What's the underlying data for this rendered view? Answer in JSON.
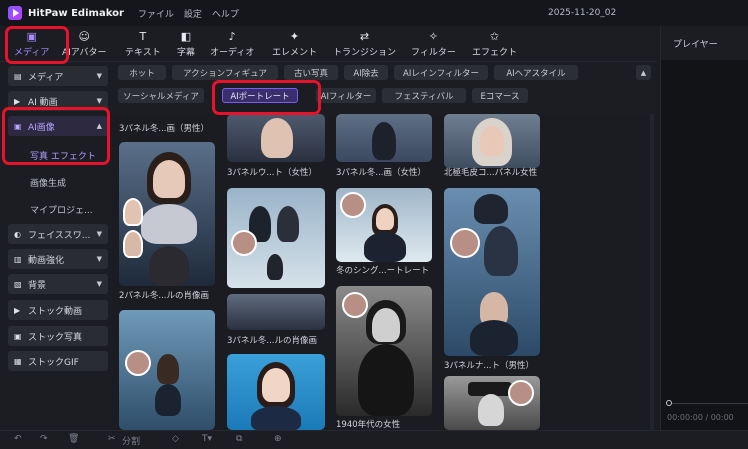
{
  "app": {
    "name": "HitPaw Edimakor",
    "menu": [
      "ファイル",
      "設定",
      "ヘルプ"
    ],
    "project": "2025-11-20_02"
  },
  "toolbar": {
    "tools": [
      {
        "label": "メディア",
        "icon": "media-icon"
      },
      {
        "label": "AIアバター",
        "icon": "avatar-icon"
      },
      {
        "label": "テキスト",
        "icon": "text-icon"
      },
      {
        "label": "字幕",
        "icon": "subtitle-icon"
      },
      {
        "label": "オーディオ",
        "icon": "audio-icon"
      },
      {
        "label": "エレメント",
        "icon": "element-icon"
      },
      {
        "label": "トランジション",
        "icon": "transition-icon"
      },
      {
        "label": "フィルター",
        "icon": "filter-icon"
      },
      {
        "label": "エフェクト",
        "icon": "effect-icon"
      }
    ]
  },
  "sidebar": {
    "media": "メディア",
    "ai_video": "AI 動画",
    "ai_image": "AI画像",
    "sub_items": [
      "写真 エフェクト",
      "画像生成",
      "マイプロジェ..."
    ],
    "face_swap": "フェイススワ...",
    "enhance": "動画強化",
    "background": "背景",
    "stock_video": "ストック動画",
    "stock_photo": "ストック写真",
    "stock_gif": "ストックGIF"
  },
  "chips": {
    "row1": [
      "ホット",
      "アクションフィギュア",
      "古い写真",
      "AI除去",
      "AIレインフィルター",
      "AIヘアスタイル"
    ],
    "row2": [
      "ソーシャルメディア",
      "AIポートレート",
      "AIフィルター",
      "フェスティバル",
      "Eコマース"
    ],
    "active": "AIポートレート"
  },
  "grid": {
    "captions": {
      "c1_top": "3パネル冬...画（男性）",
      "c1_mid": "2パネル冬...ルの肖像画",
      "c2_top": "3パネルウ...ト（女性）",
      "c2_mid": "3パネル冬...ルの肖像画",
      "c3_top": "3パネル冬...画（女性）",
      "c3_mid": "冬のシング...ートレート",
      "c3_bottom": "1940年代の女性",
      "c4_top": "北極毛皮コ...パネル女性",
      "c4_mid": "3パネルナ...ト（男性）"
    }
  },
  "player": {
    "title": "プレイヤー",
    "timecode": "00:00:00 / 00:00"
  },
  "bottom": {
    "split": "分割"
  },
  "colors": {
    "accent": "#7a5cff",
    "annotation": "#e8132b"
  }
}
